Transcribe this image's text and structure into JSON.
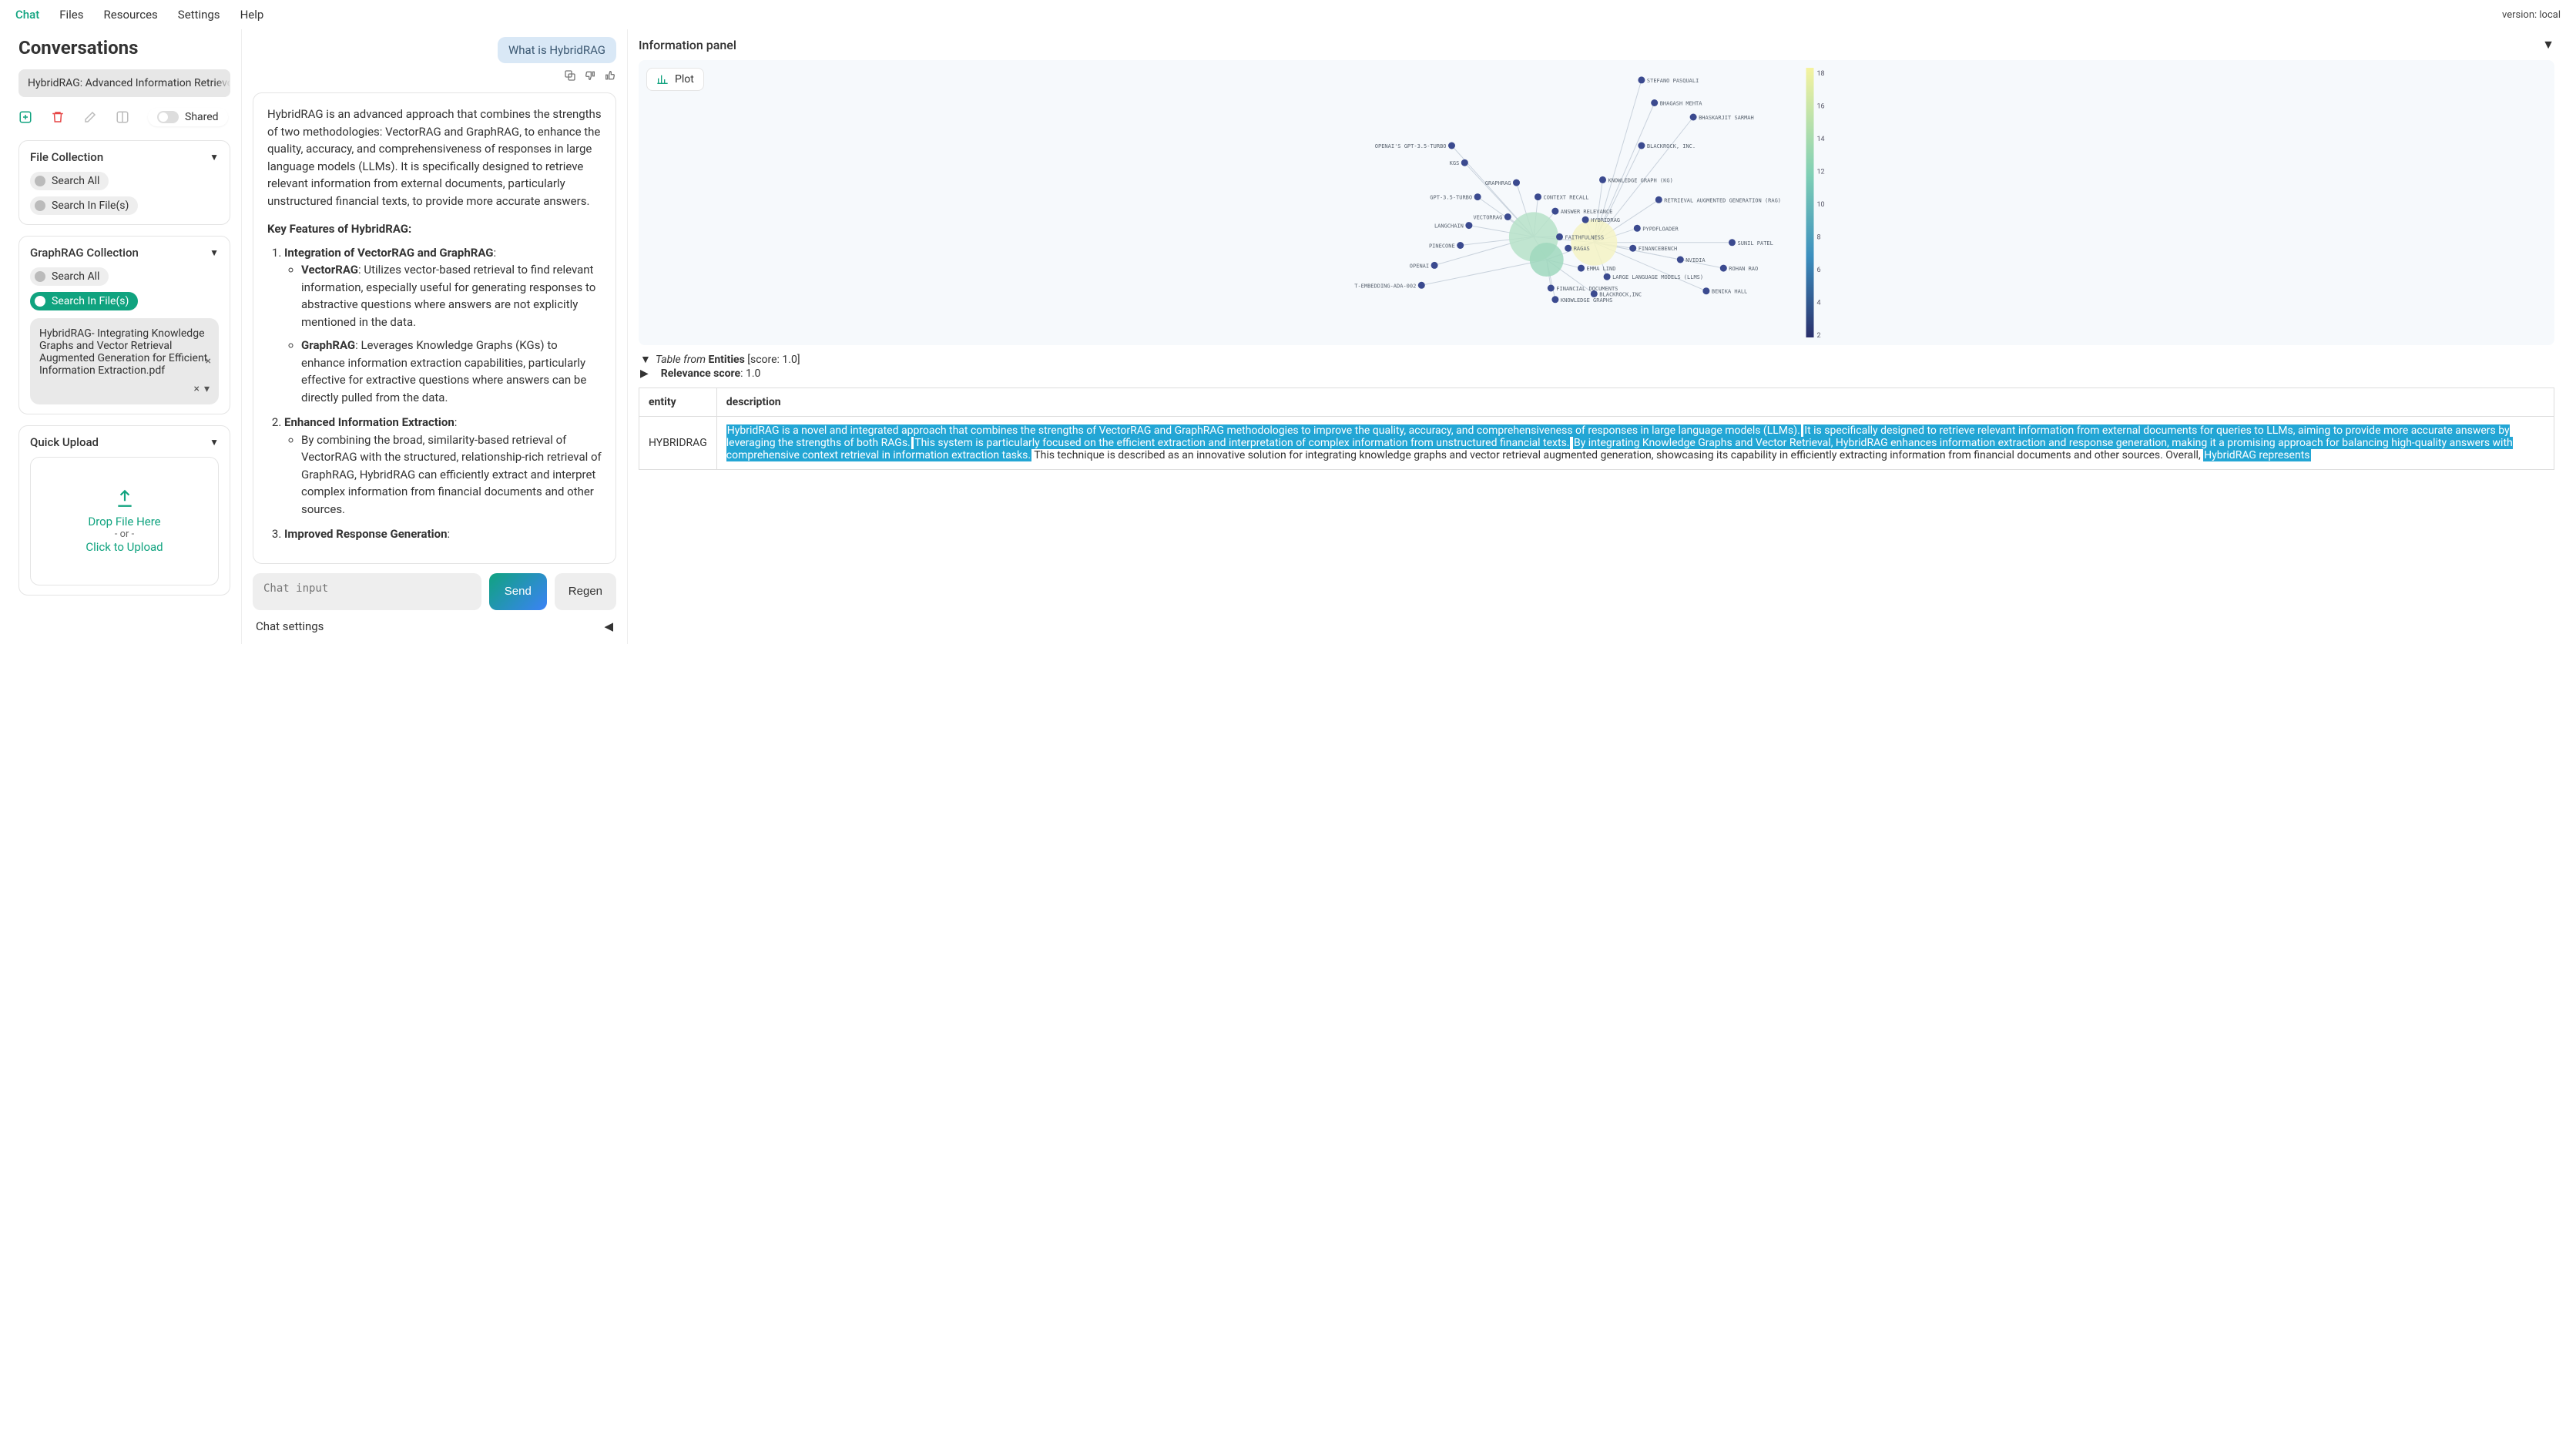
{
  "topbar": {
    "tabs": [
      "Chat",
      "Files",
      "Resources",
      "Settings",
      "Help"
    ],
    "active": 0,
    "version": "version: local"
  },
  "sidebar": {
    "title": "Conversations",
    "conversation": "HybridRAG: Advanced Information Retrievc",
    "shared_label": "Shared",
    "file_collection": {
      "title": "File Collection",
      "search_all": "Search All",
      "search_in_files": "Search In File(s)"
    },
    "graphrag_collection": {
      "title": "GraphRAG Collection",
      "search_all": "Search All",
      "search_in_files": "Search In File(s)",
      "file": "HybridRAG- Integrating Knowledge Graphs and Vector Retrieval Augmented Generation for Efficient Information Extraction.pdf"
    },
    "quick_upload": {
      "title": "Quick Upload",
      "drop": "Drop File Here",
      "or": "- or -",
      "click": "Click to Upload"
    }
  },
  "chat": {
    "user_msg": "What is HybridRAG",
    "answer_intro": "HybridRAG is an advanced approach that combines the strengths of two methodologies: VectorRAG and GraphRAG, to enhance the quality, accuracy, and comprehensiveness of responses in large language models (LLMs). It is specifically designed to retrieve relevant information from external documents, particularly unstructured financial texts, to provide more accurate answers.",
    "features_heading": "Key Features of HybridRAG:",
    "feat1_title": "Integration of VectorRAG and GraphRAG",
    "feat1_a_label": "VectorRAG",
    "feat1_a_text": ": Utilizes vector-based retrieval to find relevant information, especially useful for generating responses to abstractive questions where answers are not explicitly mentioned in the data.",
    "feat1_b_label": "GraphRAG",
    "feat1_b_text": ": Leverages Knowledge Graphs (KGs) to enhance information extraction capabilities, particularly effective for extractive questions where answers can be directly pulled from the data.",
    "feat2_title": "Enhanced Information Extraction",
    "feat2_text": "By combining the broad, similarity-based retrieval of VectorRAG with the structured, relationship-rich retrieval of GraphRAG, HybridRAG can efficiently extract and interpret complex information from financial documents and other sources.",
    "feat3_title": "Improved Response Generation",
    "input_placeholder": "Chat input",
    "send": "Send",
    "regen": "Regen",
    "settings": "Chat settings"
  },
  "info_panel": {
    "title": "Information panel",
    "plot_label": "Plot",
    "legend_ticks": [
      "18",
      "16",
      "14",
      "12",
      "10",
      "8",
      "6",
      "4",
      "2"
    ],
    "table_from": "Table from ",
    "entities": "Entities",
    "table_score": " [score: 1.0]",
    "relevance_label": "Relevance score",
    "relevance_value": ": 1.0",
    "th_entity": "entity",
    "th_desc": "description",
    "row_entity": "HYBRIDRAG",
    "row_desc_hl1": "HybridRAG is a novel and integrated approach that combines the strengths of VectorRAG and GraphRAG methodologies to improve the quality, accuracy, and comprehensiveness of responses in large language models (LLMs).",
    "row_desc_hl2": "It is specifically designed to retrieve relevant information from external documents for queries to LLMs, aiming to provide more accurate answers by leveraging the strengths of both RAGs.",
    "row_desc_hl3": "This system is particularly focused on the efficient extraction and interpretation of complex information from unstructured financial texts.",
    "row_desc_hl4": "By integrating Knowledge Graphs and Vector Retrieval, HybridRAG enhances information extraction and response generation, making it a promising approach for balancing high-quality answers with comprehensive context retrieval in information extraction tasks.",
    "row_desc_plain": " This technique is described as an innovative solution for integrating knowledge graphs and vector retrieval augmented generation, showcasing its capability in efficiently extracting information from financial documents and other sources. Overall, ",
    "row_desc_hl5": "HybridRAG represents"
  },
  "chart_data": {
    "type": "network",
    "color_scale": {
      "min": 2,
      "max": 18
    },
    "hubs": [
      {
        "id": "LLM",
        "x": 0.39,
        "y": 0.62,
        "r": 32,
        "color": "#b6e2c8"
      },
      {
        "id": "HYBRIDRAG_HUB",
        "x": 0.53,
        "y": 0.64,
        "r": 30,
        "color": "#f5f3c4"
      },
      {
        "id": "CONTEXT_PRECISION",
        "x": 0.42,
        "y": 0.7,
        "r": 22,
        "color": "#9fd8bd"
      }
    ],
    "nodes": [
      {
        "label": "STEFANO PASQUALI",
        "x": 0.64,
        "y": 0.07
      },
      {
        "label": "BHAGASH MEHTA",
        "x": 0.67,
        "y": 0.15
      },
      {
        "label": "BHASKARJIT SARMAH",
        "x": 0.76,
        "y": 0.2
      },
      {
        "label": "BLACKROCK, INC.",
        "x": 0.64,
        "y": 0.3
      },
      {
        "label": "OPENAI'S GPT-3.5-TURBO",
        "x": 0.2,
        "y": 0.3
      },
      {
        "label": "KGS",
        "x": 0.23,
        "y": 0.36
      },
      {
        "label": "GRAPHRAG",
        "x": 0.35,
        "y": 0.43
      },
      {
        "label": "KNOWLEDGE GRAPH (KG)",
        "x": 0.55,
        "y": 0.42
      },
      {
        "label": "GPT-3.5-TURBO",
        "x": 0.26,
        "y": 0.48
      },
      {
        "label": "CONTEXT RECALL",
        "x": 0.4,
        "y": 0.48
      },
      {
        "label": "RETRIEVAL AUGMENTED GENERATION (RAG)",
        "x": 0.68,
        "y": 0.49
      },
      {
        "label": "VECTORRAG",
        "x": 0.33,
        "y": 0.55
      },
      {
        "label": "ANSWER RELEVANCE",
        "x": 0.44,
        "y": 0.53
      },
      {
        "label": "LANGCHAIN",
        "x": 0.24,
        "y": 0.58
      },
      {
        "label": "HYBRIDRAG",
        "x": 0.51,
        "y": 0.56
      },
      {
        "label": "PYPDFLOADER",
        "x": 0.63,
        "y": 0.59
      },
      {
        "label": "PINECONE",
        "x": 0.22,
        "y": 0.65
      },
      {
        "label": "FAITHFULNESS",
        "x": 0.45,
        "y": 0.62
      },
      {
        "label": "FINANCEBENCH",
        "x": 0.62,
        "y": 0.66
      },
      {
        "label": "SUNIL PATEL",
        "x": 0.85,
        "y": 0.64
      },
      {
        "label": "OPENAI",
        "x": 0.16,
        "y": 0.72
      },
      {
        "label": "NVIDIA",
        "x": 0.73,
        "y": 0.7
      },
      {
        "label": "EMMA LIND",
        "x": 0.5,
        "y": 0.73
      },
      {
        "label": "ROHAN RAO",
        "x": 0.83,
        "y": 0.73
      },
      {
        "label": "LARGE LANGUAGE MODELS (LLMS)",
        "x": 0.56,
        "y": 0.76
      },
      {
        "label": "T-EMBEDDING-ADA-002",
        "x": 0.13,
        "y": 0.79
      },
      {
        "label": "FINANCIAL DOCUMENTS",
        "x": 0.43,
        "y": 0.8
      },
      {
        "label": "KNOWLEDGE GRAPHS",
        "x": 0.44,
        "y": 0.84
      },
      {
        "label": "BLACKROCK,INC",
        "x": 0.53,
        "y": 0.82
      },
      {
        "label": "BENIKA HALL",
        "x": 0.79,
        "y": 0.81
      },
      {
        "label": "RAGAS",
        "x": 0.47,
        "y": 0.66
      }
    ]
  }
}
